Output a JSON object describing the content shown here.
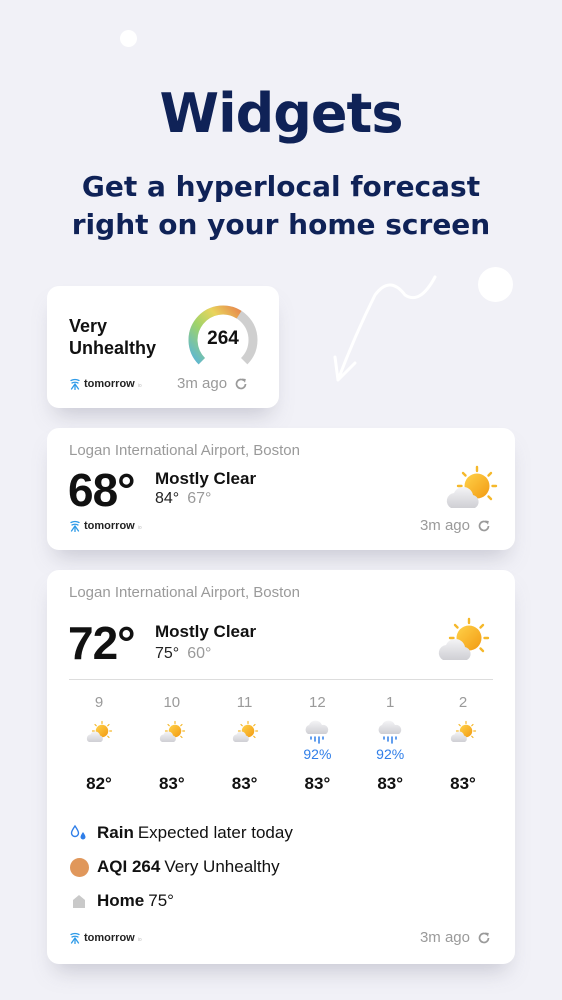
{
  "hero": {
    "title": "Widgets",
    "subtitle_line1": "Get a hyperlocal forecast",
    "subtitle_line2": "right on your home screen"
  },
  "brand": {
    "name": "tomorrow",
    "suffix": "io"
  },
  "colors": {
    "navy": "#0f2257",
    "aqi_orange": "#e0975b",
    "precip_blue": "#2f7ee8",
    "muted_gray": "#9a9a9a"
  },
  "aqi_widget": {
    "label_line1": "Very",
    "label_line2": "Unhealthy",
    "value": "264",
    "gauge_fraction": 0.62,
    "updated": "3m ago"
  },
  "small_widget": {
    "location": "Logan International Airport, Boston",
    "temp": "68°",
    "condition": "Mostly Clear",
    "high": "84°",
    "low": "67°",
    "icon": "partly-sunny-icon",
    "updated": "3m ago"
  },
  "large_widget": {
    "location": "Logan International Airport, Boston",
    "temp": "72°",
    "condition": "Mostly Clear",
    "high": "75°",
    "low": "60°",
    "icon": "partly-sunny-icon",
    "hourly": [
      {
        "time": "9",
        "icon": "partly-sunny-icon",
        "precip": "",
        "temp": "82°"
      },
      {
        "time": "10",
        "icon": "partly-sunny-icon",
        "precip": "",
        "temp": "83°"
      },
      {
        "time": "11",
        "icon": "partly-sunny-icon",
        "precip": "",
        "temp": "83°"
      },
      {
        "time": "12",
        "icon": "rain-cloud-icon",
        "precip": "92%",
        "temp": "83°"
      },
      {
        "time": "1",
        "icon": "rain-cloud-icon",
        "precip": "92%",
        "temp": "83°"
      },
      {
        "time": "2",
        "icon": "partly-sunny-icon",
        "precip": "",
        "temp": "83°"
      }
    ],
    "rain": {
      "bold": "Rain",
      "text": "Expected later today"
    },
    "aqi": {
      "bold": "AQI 264",
      "text": "Very Unhealthy"
    },
    "home": {
      "bold": "Home",
      "text": "75°"
    },
    "updated": "3m ago"
  }
}
